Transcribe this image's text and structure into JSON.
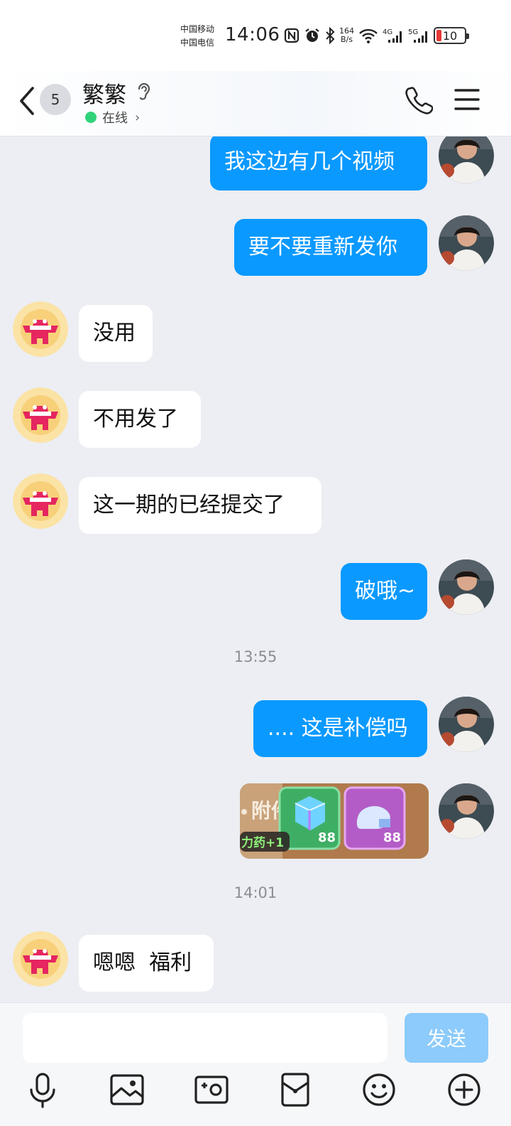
{
  "status_bar": {
    "carrier_1": "中国移动",
    "carrier_2": "中国电信",
    "time": "14:06",
    "net_speed_value": "164",
    "net_speed_unit": "B/s",
    "battery": "10",
    "icons": [
      "nfc-icon",
      "alarm-icon",
      "bluetooth-icon",
      "wifi-icon",
      "signal-4g-icon",
      "signal-5g-icon",
      "battery-icon"
    ]
  },
  "header": {
    "unread_count": "5",
    "contact_name": "繁繁",
    "status_text": "在线",
    "status_color": "#2fd27a"
  },
  "colors": {
    "outgoing_bubble": "#0a99ff",
    "incoming_bubble": "#ffffff",
    "background": "#eceef3",
    "send_button": "#8ccbfb"
  },
  "messages": [
    {
      "side": "me",
      "text": "我这边有几个视频"
    },
    {
      "side": "me",
      "text": "要不要重新发你"
    },
    {
      "side": "them",
      "text": "没用"
    },
    {
      "side": "them",
      "text": "不用发了"
    },
    {
      "side": "them",
      "text": "这一期的已经提交了"
    },
    {
      "side": "me",
      "text": "破哦~"
    },
    {
      "timestamp": "13:55"
    },
    {
      "side": "me",
      "text": ".... 这是补偿吗"
    },
    {
      "side": "me",
      "type": "image",
      "sticker": {
        "badge_text": "附件",
        "label": "力药+1",
        "count_1": "88",
        "count_2": "88"
      }
    },
    {
      "timestamp": "14:01"
    },
    {
      "side": "them",
      "text": "嗯嗯  福利"
    }
  ],
  "input": {
    "placeholder": "",
    "send_label": "发送"
  },
  "toolbar": [
    "microphone-icon",
    "image-icon",
    "camera-icon",
    "red-packet-icon",
    "emoji-icon",
    "plus-icon"
  ]
}
